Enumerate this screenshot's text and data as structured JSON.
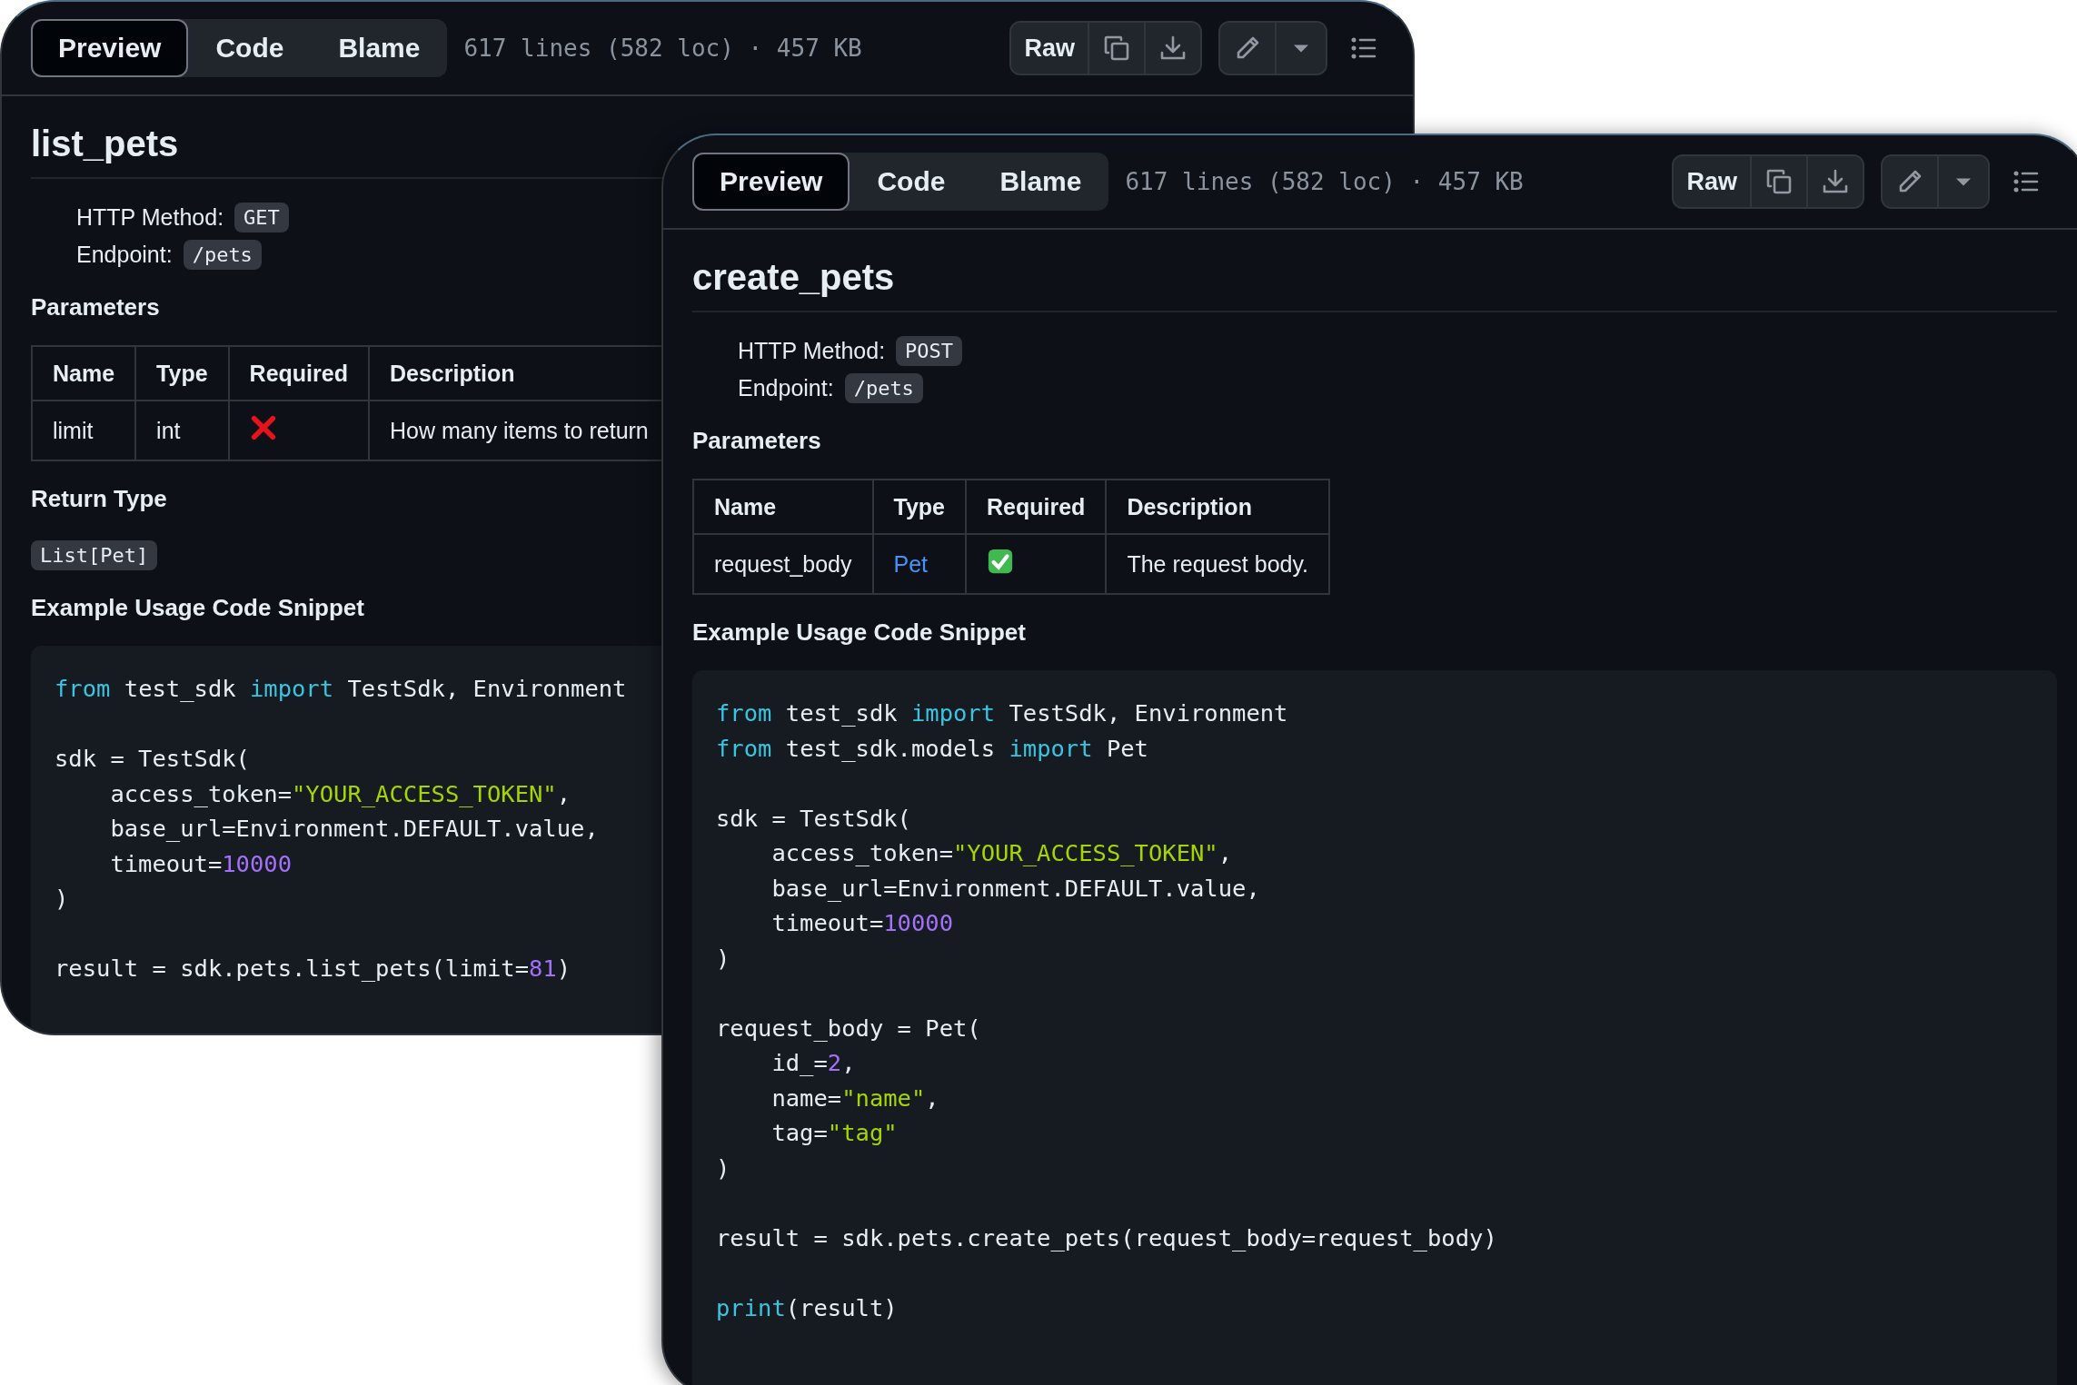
{
  "windows": [
    {
      "tabs": [
        {
          "label": "Preview",
          "selected": true
        },
        {
          "label": "Code",
          "selected": false
        },
        {
          "label": "Blame",
          "selected": false
        }
      ],
      "file_info": "617 lines (582 loc) · 457 KB",
      "raw_button": "Raw",
      "title": "list_pets",
      "http_method_label": "HTTP Method:",
      "http_method": "GET",
      "endpoint_label": "Endpoint:",
      "endpoint": "/pets",
      "parameters_heading": "Parameters",
      "table": {
        "columns": [
          "Name",
          "Type",
          "Required",
          "Description"
        ],
        "rows": [
          {
            "name": "limit",
            "type": "int",
            "type_is_link": false,
            "required": false,
            "description": "How many items to return"
          }
        ]
      },
      "return_type_heading": "Return Type",
      "return_type": "List[Pet]",
      "example_heading": "Example Usage Code Snippet",
      "code": [
        {
          "kind": "code",
          "tokens": [
            {
              "kind": "kw",
              "text": "from"
            },
            {
              "kind": "plain",
              "text": " test_sdk "
            },
            {
              "kind": "kw",
              "text": "import"
            },
            {
              "kind": "plain",
              "text": " TestSdk, Environment"
            }
          ]
        },
        {
          "kind": "blank"
        },
        {
          "kind": "code",
          "tokens": [
            {
              "kind": "plain",
              "text": "sdk = TestSdk("
            }
          ]
        },
        {
          "kind": "code",
          "tokens": [
            {
              "kind": "plain",
              "text": "    access_token="
            },
            {
              "kind": "str",
              "text": "\"YOUR_ACCESS_TOKEN\""
            },
            {
              "kind": "plain",
              "text": ","
            }
          ]
        },
        {
          "kind": "code",
          "tokens": [
            {
              "kind": "plain",
              "text": "    base_url=Environment.DEFAULT.value,"
            }
          ]
        },
        {
          "kind": "code",
          "tokens": [
            {
              "kind": "plain",
              "text": "    timeout="
            },
            {
              "kind": "num",
              "text": "10000"
            }
          ]
        },
        {
          "kind": "code",
          "tokens": [
            {
              "kind": "plain",
              "text": ")"
            }
          ]
        },
        {
          "kind": "blank"
        },
        {
          "kind": "code",
          "tokens": [
            {
              "kind": "plain",
              "text": "result = sdk.pets.list_pets(limit="
            },
            {
              "kind": "num",
              "text": "81"
            },
            {
              "kind": "plain",
              "text": ")"
            }
          ]
        }
      ]
    },
    {
      "tabs": [
        {
          "label": "Preview",
          "selected": true
        },
        {
          "label": "Code",
          "selected": false
        },
        {
          "label": "Blame",
          "selected": false
        }
      ],
      "file_info": "617 lines (582 loc) · 457 KB",
      "raw_button": "Raw",
      "title": "create_pets",
      "http_method_label": "HTTP Method:",
      "http_method": "POST",
      "endpoint_label": "Endpoint:",
      "endpoint": "/pets",
      "parameters_heading": "Parameters",
      "table": {
        "columns": [
          "Name",
          "Type",
          "Required",
          "Description"
        ],
        "rows": [
          {
            "name": "request_body",
            "type": "Pet",
            "type_is_link": true,
            "required": true,
            "description": "The request body."
          }
        ]
      },
      "example_heading": "Example Usage Code Snippet",
      "code": [
        {
          "kind": "code",
          "tokens": [
            {
              "kind": "kw",
              "text": "from"
            },
            {
              "kind": "plain",
              "text": " test_sdk "
            },
            {
              "kind": "kw",
              "text": "import"
            },
            {
              "kind": "plain",
              "text": " TestSdk, Environment"
            }
          ]
        },
        {
          "kind": "code",
          "tokens": [
            {
              "kind": "kw",
              "text": "from"
            },
            {
              "kind": "plain",
              "text": " test_sdk.models "
            },
            {
              "kind": "kw",
              "text": "import"
            },
            {
              "kind": "plain",
              "text": " Pet"
            }
          ]
        },
        {
          "kind": "blank"
        },
        {
          "kind": "code",
          "tokens": [
            {
              "kind": "plain",
              "text": "sdk = TestSdk("
            }
          ]
        },
        {
          "kind": "code",
          "tokens": [
            {
              "kind": "plain",
              "text": "    access_token="
            },
            {
              "kind": "str",
              "text": "\"YOUR_ACCESS_TOKEN\""
            },
            {
              "kind": "plain",
              "text": ","
            }
          ]
        },
        {
          "kind": "code",
          "tokens": [
            {
              "kind": "plain",
              "text": "    base_url=Environment.DEFAULT.value,"
            }
          ]
        },
        {
          "kind": "code",
          "tokens": [
            {
              "kind": "plain",
              "text": "    timeout="
            },
            {
              "kind": "num",
              "text": "10000"
            }
          ]
        },
        {
          "kind": "code",
          "tokens": [
            {
              "kind": "plain",
              "text": ")"
            }
          ]
        },
        {
          "kind": "blank"
        },
        {
          "kind": "code",
          "tokens": [
            {
              "kind": "plain",
              "text": "request_body = Pet("
            }
          ]
        },
        {
          "kind": "code",
          "tokens": [
            {
              "kind": "plain",
              "text": "    id_="
            },
            {
              "kind": "num",
              "text": "2"
            },
            {
              "kind": "plain",
              "text": ","
            }
          ]
        },
        {
          "kind": "code",
          "tokens": [
            {
              "kind": "plain",
              "text": "    name="
            },
            {
              "kind": "str",
              "text": "\"name\""
            },
            {
              "kind": "plain",
              "text": ","
            }
          ]
        },
        {
          "kind": "code",
          "tokens": [
            {
              "kind": "plain",
              "text": "    tag="
            },
            {
              "kind": "str",
              "text": "\"tag\""
            }
          ]
        },
        {
          "kind": "code",
          "tokens": [
            {
              "kind": "plain",
              "text": ")"
            }
          ]
        },
        {
          "kind": "blank"
        },
        {
          "kind": "code",
          "tokens": [
            {
              "kind": "plain",
              "text": "result = sdk.pets.create_pets(request_body=request_body)"
            }
          ]
        },
        {
          "kind": "blank"
        },
        {
          "kind": "code",
          "tokens": [
            {
              "kind": "kw",
              "text": "print"
            },
            {
              "kind": "plain",
              "text": "(result)"
            }
          ]
        }
      ]
    }
  ]
}
